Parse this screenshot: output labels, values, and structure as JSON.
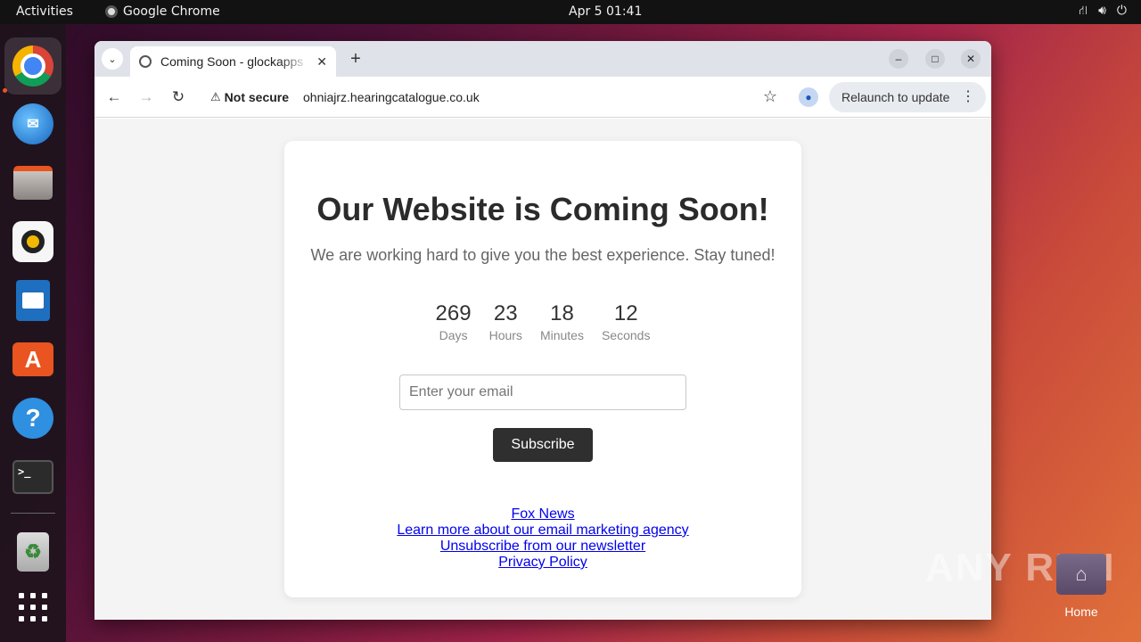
{
  "topbar": {
    "activities": "Activities",
    "app_name": "Google Chrome",
    "clock": "Apr 5  01:41",
    "tray_icons": [
      "network-icon",
      "volume-icon",
      "power-icon"
    ]
  },
  "dock": {
    "items": [
      "chrome",
      "thunderbird",
      "files",
      "rhythmbox",
      "libreoffice-writer",
      "app-center",
      "help",
      "terminal",
      "trash",
      "show-apps"
    ]
  },
  "browser": {
    "tab_title": "Coming Soon - glockapps",
    "address": {
      "security_label": "Not secure",
      "url": "ohniajrz.hearingcatalogue.co.uk"
    },
    "relaunch_label": "Relaunch to update"
  },
  "page": {
    "heading": "Our Website is Coming Soon!",
    "subtitle": "We are working hard to give you the best experience. Stay tuned!",
    "countdown": [
      {
        "value": "269",
        "label": "Days"
      },
      {
        "value": "23",
        "label": "Hours"
      },
      {
        "value": "18",
        "label": "Minutes"
      },
      {
        "value": "12",
        "label": "Seconds"
      }
    ],
    "email_placeholder": "Enter your email",
    "subscribe_label": "Subscribe",
    "links": [
      "Fox News",
      "Learn more about our email marketing agency",
      "Unsubscribe from our newsletter",
      "Privacy Policy"
    ]
  },
  "desktop": {
    "watermark": "ANY RUN",
    "home_label": "Home"
  }
}
